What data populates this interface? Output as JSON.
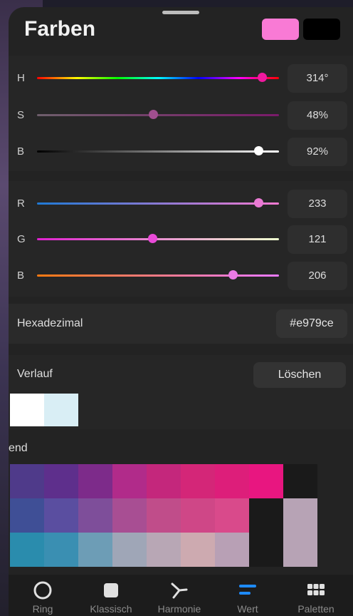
{
  "title": "Farben",
  "colors": {
    "primary": "#f97ad5",
    "secondary": "#000000"
  },
  "hsb": [
    {
      "key": "h",
      "label": "H",
      "value": "314°",
      "fraction": 0.93,
      "track": "linear-gradient(90deg,#ff0000,#ffff00,#00ff00,#00ffff,#0000ff,#ff00ff,#ff0000)",
      "thumb_color": "#f0199f"
    },
    {
      "key": "s",
      "label": "S",
      "value": "48%",
      "fraction": 0.48,
      "track": "linear-gradient(90deg,#6e5e6b,#7a1a6a)",
      "thumb_color": "#a04f8f"
    },
    {
      "key": "b",
      "label": "B",
      "value": "92%",
      "fraction": 0.915,
      "track": "linear-gradient(90deg,#000000,#ffffff)",
      "thumb_color": "#ffffff"
    }
  ],
  "rgb": [
    {
      "key": "r",
      "label": "R",
      "value": "233",
      "fraction": 0.914,
      "track": "linear-gradient(90deg,#1f79d4,#f57ad2)",
      "thumb_color": "#ea7ad4"
    },
    {
      "key": "g",
      "label": "G",
      "value": "121",
      "fraction": 0.475,
      "track": "linear-gradient(90deg,#e020d0,#efffd0)",
      "thumb_color": "#e94ad8"
    },
    {
      "key": "b",
      "label": "B",
      "value": "206",
      "fraction": 0.808,
      "track": "linear-gradient(90deg,#ff7a10,#ea7aff)",
      "thumb_color": "#ea7ae4"
    }
  ],
  "hex": {
    "label": "Hexadezimal",
    "value": "#e979ce"
  },
  "verlauf": {
    "label": "Verlauf",
    "clear_label": "Löschen",
    "history": [
      "#ffffff",
      "#d9eef5"
    ]
  },
  "palette": {
    "label": "end",
    "rows": [
      [
        "#4f3a8a",
        "#5e2f8c",
        "#7d2b8a",
        "#b12b8a",
        "#c4277c",
        "#d42678",
        "#dd1e7a",
        "#e81680",
        "#1a1a1a"
      ],
      [
        "#3f4f96",
        "#5a4ea0",
        "#7e4e9a",
        "#a84e93",
        "#c04d8a",
        "#cf4787",
        "#d94a8b",
        "#1a1a1a",
        "#b7a3b5"
      ],
      [
        "#2a8cad",
        "#3a8fb2",
        "#6d9db6",
        "#9fa6b7",
        "#b8a7b5",
        "#cdaab0",
        "#b8a0b5",
        "#1a1a1a",
        "#b7a3b5"
      ]
    ]
  },
  "tabs": [
    {
      "key": "ring",
      "label": "Ring",
      "icon": "circle-outline-icon"
    },
    {
      "key": "klassisch",
      "label": "Klassisch",
      "icon": "square-icon"
    },
    {
      "key": "harmonie",
      "label": "Harmonie",
      "icon": "harmonie-icon"
    },
    {
      "key": "wert",
      "label": "Wert",
      "icon": "sliders-icon",
      "active": true
    },
    {
      "key": "paletten",
      "label": "Paletten",
      "icon": "grid-icon"
    }
  ]
}
